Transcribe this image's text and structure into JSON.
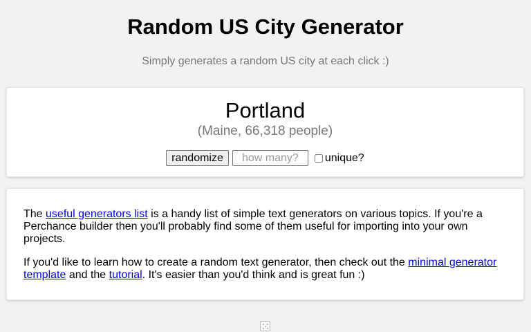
{
  "header": {
    "title": "Random US City Generator",
    "subtitle": "Simply generates a random US city at each click :)"
  },
  "output": {
    "city": "Portland",
    "detail": "(Maine, 66,318 people)"
  },
  "controls": {
    "randomize_label": "randomize",
    "count_placeholder": "how many?",
    "count_value": "",
    "unique_label": "unique?",
    "unique_checked": false
  },
  "info": {
    "p1_pre": "The ",
    "p1_link": "useful generators list",
    "p1_post": " is a handy list of simple text generators on various topics. If you're a Perchance builder then you'll probably find some of them useful for importing into your own projects.",
    "p2_pre": "If you'd like to learn how to create a random text generator, then check out the ",
    "p2_link1": "minimal generator template",
    "p2_mid": " and the ",
    "p2_link2": "tutorial",
    "p2_post": ". It's easier than you'd think and is great fun :)"
  },
  "footer": {
    "icon": "dice-icon"
  }
}
